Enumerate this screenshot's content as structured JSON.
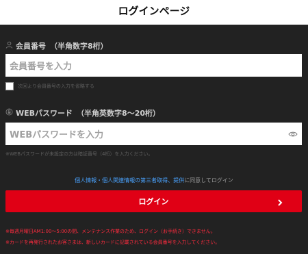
{
  "header": {
    "title": "ログインページ"
  },
  "member": {
    "label": "会員番号",
    "hint": "（半角数字8桁）",
    "placeholder": "会員番号を入力",
    "remember_label": "次回より会員番号の入力を省略する",
    "icon": "user-icon"
  },
  "password": {
    "label": "WEBパスワード",
    "hint": "（半角英数字8～20桁）",
    "placeholder": "WEBパスワードを入力",
    "note": "※WEBパスワードが未設定の方は暗証番号（4桁）を入力ください。",
    "icon": "lock-icon",
    "toggle_icon": "eye-icon"
  },
  "privacy": {
    "link": "個人情報・個人関連情報の第三者取得、提供",
    "rest": "に同意してログイン"
  },
  "login_button": {
    "label": "ログイン",
    "icon": "chevron-right-icon"
  },
  "notes": [
    "※毎週月曜日AM1:00～5:00の間、メンテナンス作業のため、ログイン（お手続き）できません。",
    "※カードを再発行されたお客さまは、新しいカードに記載されている会員番号を入力してください。"
  ],
  "colors": {
    "accent": "#e00015",
    "background": "#222222",
    "link": "#4aa3ff",
    "warning": "#ff2b3e"
  }
}
